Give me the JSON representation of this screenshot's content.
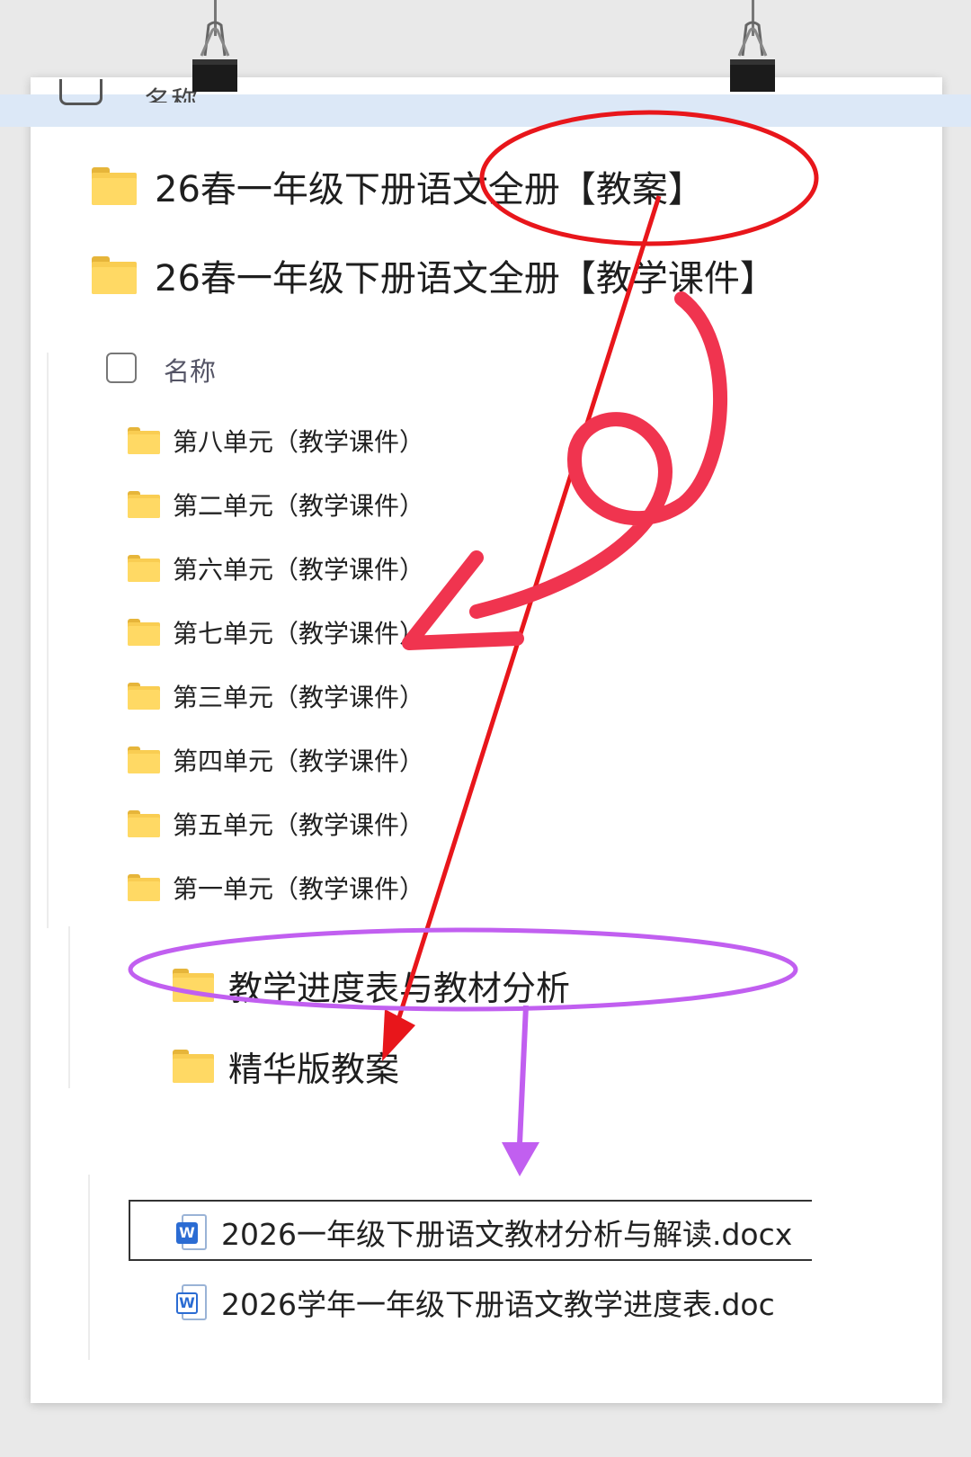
{
  "header_strip": {
    "partial_text": "名称"
  },
  "top_folders": [
    {
      "label": "26春一年级下册语文全册【教案】"
    },
    {
      "label": "26春一年级下册语文全册【教学课件】"
    }
  ],
  "list_header": {
    "name_column": "名称"
  },
  "unit_folders": [
    {
      "label": "第八单元（教学课件）"
    },
    {
      "label": "第二单元（教学课件）"
    },
    {
      "label": "第六单元（教学课件）"
    },
    {
      "label": "第七单元（教学课件）"
    },
    {
      "label": "第三单元（教学课件）"
    },
    {
      "label": "第四单元（教学课件）"
    },
    {
      "label": "第五单元（教学课件）"
    },
    {
      "label": "第一单元（教学课件）"
    }
  ],
  "plan_folders": [
    {
      "label": "教学进度表与教材分析"
    },
    {
      "label": "精华版教案"
    }
  ],
  "files": [
    {
      "label": "2026一年级下册语文教材分析与解读.docx",
      "icon": "word-doc-icon",
      "selected": true
    },
    {
      "label": "2026学年一年级下册语文教学进度表.doc",
      "icon": "word-doc-icon",
      "selected": false
    }
  ],
  "colors": {
    "header_strip": "#dce8f7",
    "folder": "#ffd964",
    "red_annotation": "#e8161b",
    "pink_annotation": "#f0344f",
    "purple_annotation": "#c15ff0",
    "word_blue": "#2b6cd3"
  }
}
